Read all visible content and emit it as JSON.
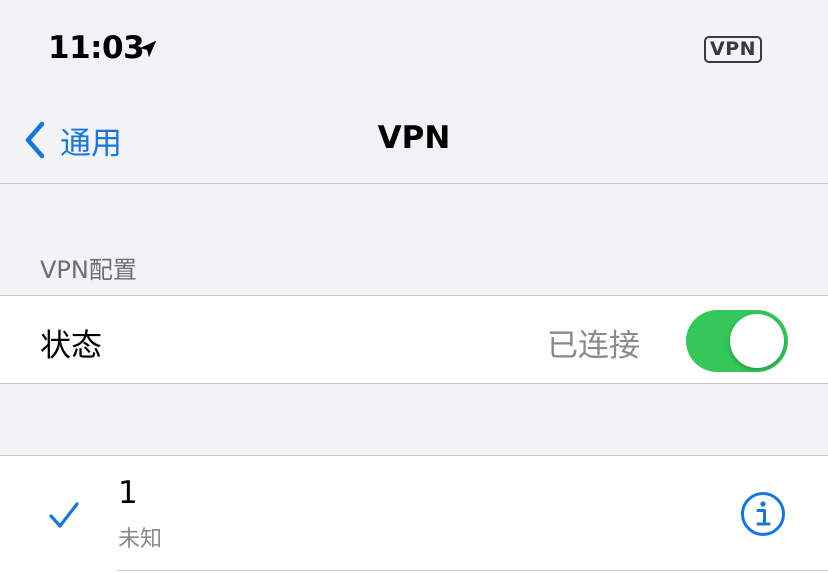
{
  "status_bar": {
    "time": "11:03",
    "location_icon": "location-arrow-icon",
    "vpn_indicator": "VPN"
  },
  "nav": {
    "back_label": "通用",
    "back_icon": "chevron-left-icon",
    "title": "VPN"
  },
  "section": {
    "header": "VPN配置"
  },
  "status_row": {
    "label": "状态",
    "value": "已连接",
    "toggle_on": true
  },
  "vpn_config": {
    "name": "1",
    "subtitle": "未知",
    "selected": true,
    "check_icon": "checkmark-icon",
    "info_icon": "info-circle-icon"
  },
  "colors": {
    "accent": "#1677d9",
    "toggle_on": "#34c759",
    "background": "#f2f2f7",
    "secondary_text": "#8a8a8e"
  }
}
